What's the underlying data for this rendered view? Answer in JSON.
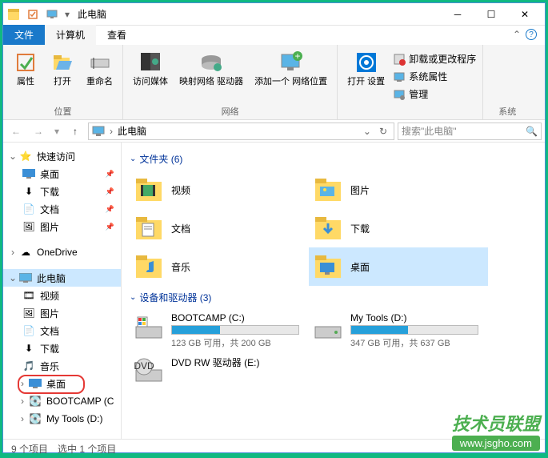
{
  "title": "此电脑",
  "tabs": {
    "file": "文件",
    "computer": "计算机",
    "view": "查看"
  },
  "ribbon": {
    "location": {
      "label": "位置",
      "props": "属性",
      "open": "打开",
      "rename": "重命名"
    },
    "network": {
      "label": "网络",
      "media": "访问媒体",
      "mapdrive": "映射网络\n驱动器",
      "addloc": "添加一个\n网络位置"
    },
    "system": {
      "label": "系统",
      "settings": "打开\n设置",
      "uninstall": "卸载或更改程序",
      "sysprops": "系统属性",
      "manage": "管理"
    }
  },
  "address": "此电脑",
  "search_placeholder": "搜索\"此电脑\"",
  "sidebar": {
    "quick": "快速访问",
    "desktop": "桌面",
    "downloads": "下载",
    "documents": "文档",
    "pictures": "图片",
    "onedrive": "OneDrive",
    "thispc": "此电脑",
    "video": "视频",
    "pictures2": "图片",
    "documents2": "文档",
    "downloads2": "下载",
    "music": "音乐",
    "desktop2": "桌面",
    "bootcamp": "BOOTCAMP (C",
    "mytools": "My Tools (D:)"
  },
  "sections": {
    "folders": "文件夹 (6)",
    "drives": "设备和驱动器 (3)"
  },
  "folders": {
    "video": "视频",
    "pictures": "图片",
    "documents": "文档",
    "downloads": "下载",
    "music": "音乐",
    "desktop": "桌面"
  },
  "drives": {
    "c": {
      "name": "BOOTCAMP (C:)",
      "info": "123 GB 可用，共 200 GB",
      "pct": 38
    },
    "d": {
      "name": "My Tools (D:)",
      "info": "347 GB 可用，共 637 GB",
      "pct": 45
    },
    "e": {
      "name": "DVD RW 驱动器 (E:)"
    }
  },
  "status": {
    "items": "9 个项目",
    "selected": "选中 1 个项目"
  },
  "watermark": {
    "line1": "技术员联盟",
    "line2": "www.jsgho.com"
  }
}
